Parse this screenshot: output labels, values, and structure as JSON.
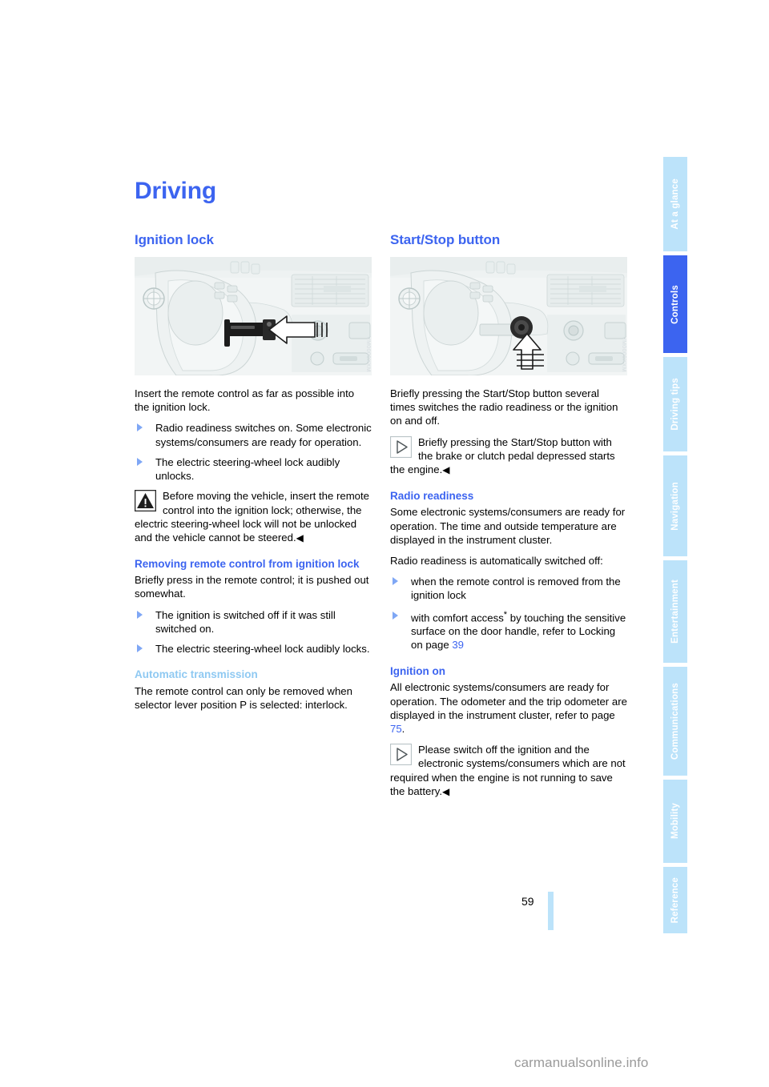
{
  "chapter_title": "Driving",
  "page_number": "59",
  "site_watermark": "carmanualsonline.info",
  "colors": {
    "accent_blue": "#3c64f0",
    "tab_light": "#bce3fa",
    "sub_light": "#8fc9f2",
    "bullet_blue": "#7fa7f5"
  },
  "sidebar": {
    "items": [
      {
        "label": "At a glance",
        "active": false
      },
      {
        "label": "Controls",
        "active": true
      },
      {
        "label": "Driving tips",
        "active": false
      },
      {
        "label": "Navigation",
        "active": false
      },
      {
        "label": "Entertainment",
        "active": false
      },
      {
        "label": "Communications",
        "active": false
      },
      {
        "label": "Mobility",
        "active": false
      },
      {
        "label": "Reference",
        "active": false
      }
    ]
  },
  "left_column": {
    "heading": "Ignition lock",
    "figure_caption": "Steering wheel with remote control inserted into ignition lock",
    "figure_watermark": "VM0000XXM",
    "intro": "Insert the remote control as far as possible into the ignition lock.",
    "bullets": [
      "Radio readiness switches on. Some electronic systems/consumers are ready for operation.",
      "The electric steering-wheel lock audibly unlocks."
    ],
    "warning": {
      "icon": "warning-triangle-icon",
      "text": "Before moving the vehicle, insert the remote control into the ignition lock; otherwise, the electric steering-wheel lock will not be unlocked and the vehicle cannot be steered.",
      "end": "◀"
    },
    "sub1": {
      "heading": "Removing remote control from ignition lock",
      "intro": "Briefly press in the remote control; it is pushed out somewhat.",
      "bullets": [
        "The ignition is switched off if it was still switched on.",
        "The electric steering-wheel lock audibly locks."
      ]
    },
    "sub2": {
      "heading": "Automatic transmission",
      "text": "The remote control can only be removed when selector lever position P is selected: interlock."
    }
  },
  "right_column": {
    "heading": "Start/Stop button",
    "figure_caption": "Steering wheel with Start/Stop button highlighted",
    "figure_watermark": "VM0000XXM",
    "intro": "Briefly pressing the Start/Stop button several times switches the radio readiness or the ignition on and off.",
    "note1": {
      "icon": "info-triangle-icon",
      "text": "Briefly pressing the Start/Stop button with the brake or clutch pedal depressed starts the engine.",
      "end": "◀"
    },
    "sub1": {
      "heading": "Radio readiness",
      "para1": "Some electronic systems/consumers are ready for operation. The time and outside temperature are displayed in the instrument cluster.",
      "para2": "Radio readiness is automatically switched off:",
      "bullets": [
        {
          "text": "when the remote control is removed from the ignition lock"
        },
        {
          "text_before": "with comfort access",
          "asterisk": "*",
          "text_mid": " by touching the sensitive surface on the door handle, refer to Locking on page ",
          "page_link": "39"
        }
      ]
    },
    "sub2": {
      "heading": "Ignition on",
      "para_before": "All electronic systems/consumers are ready for operation. The odometer and the trip odometer are displayed in the instrument cluster, refer to page ",
      "page_link": "75",
      "para_after": ".",
      "note": {
        "icon": "info-triangle-icon",
        "text": "Please switch off the ignition and the electronic systems/consumers which are not required when the engine is not running to save the battery.",
        "end": "◀"
      }
    }
  }
}
